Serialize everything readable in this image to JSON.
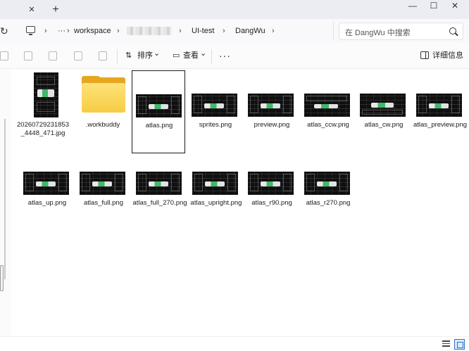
{
  "window": {
    "close_tab_glyph": "✕",
    "new_tab_glyph": "+",
    "minimize_glyph": "—",
    "maximize_glyph": "☐",
    "close_glyph": "✕"
  },
  "address": {
    "refresh_glyph": "↻",
    "overflow_glyph": "···",
    "chevron_glyph": "›",
    "breadcrumbs": [
      "workspace",
      "UI-test",
      "DangWu"
    ],
    "search_placeholder": "在 DangWu 中搜索"
  },
  "toolbar": {
    "sort_label": "排序",
    "view_label": "查看",
    "dropdown_glyph": "⌄",
    "more_glyph": "···",
    "details_label": "详细信息"
  },
  "files": [
    {
      "name": "20260729231853_4448_471.jpg",
      "kind": "portrait-image"
    },
    {
      "name": ".workbuddy",
      "kind": "folder"
    },
    {
      "name": "atlas.png",
      "kind": "image",
      "selected": true
    },
    {
      "name": "sprites.png",
      "kind": "image"
    },
    {
      "name": "preview.png",
      "kind": "image"
    },
    {
      "name": "atlas_ccw.png",
      "kind": "image"
    },
    {
      "name": "atlas_cw.png",
      "kind": "image"
    },
    {
      "name": "atlas_preview.png",
      "kind": "image"
    },
    {
      "name": "atlas_up.png",
      "kind": "image"
    },
    {
      "name": "atlas_full.png",
      "kind": "image"
    },
    {
      "name": "atlas_full_270.png",
      "kind": "image"
    },
    {
      "name": "atlas_upright.png",
      "kind": "image"
    },
    {
      "name": "atlas_r90.png",
      "kind": "image"
    },
    {
      "name": "atlas_r270.png",
      "kind": "image"
    }
  ],
  "colors": {
    "accent": "#2c73c8",
    "folder": "#f8cc43",
    "thumb_green": "#40b86a"
  },
  "icons": [
    "refresh-icon",
    "computer-icon",
    "search-icon",
    "sort-icon",
    "view-icon",
    "details-pane-icon",
    "folder-icon",
    "list-view-icon",
    "tiles-view-icon"
  ]
}
